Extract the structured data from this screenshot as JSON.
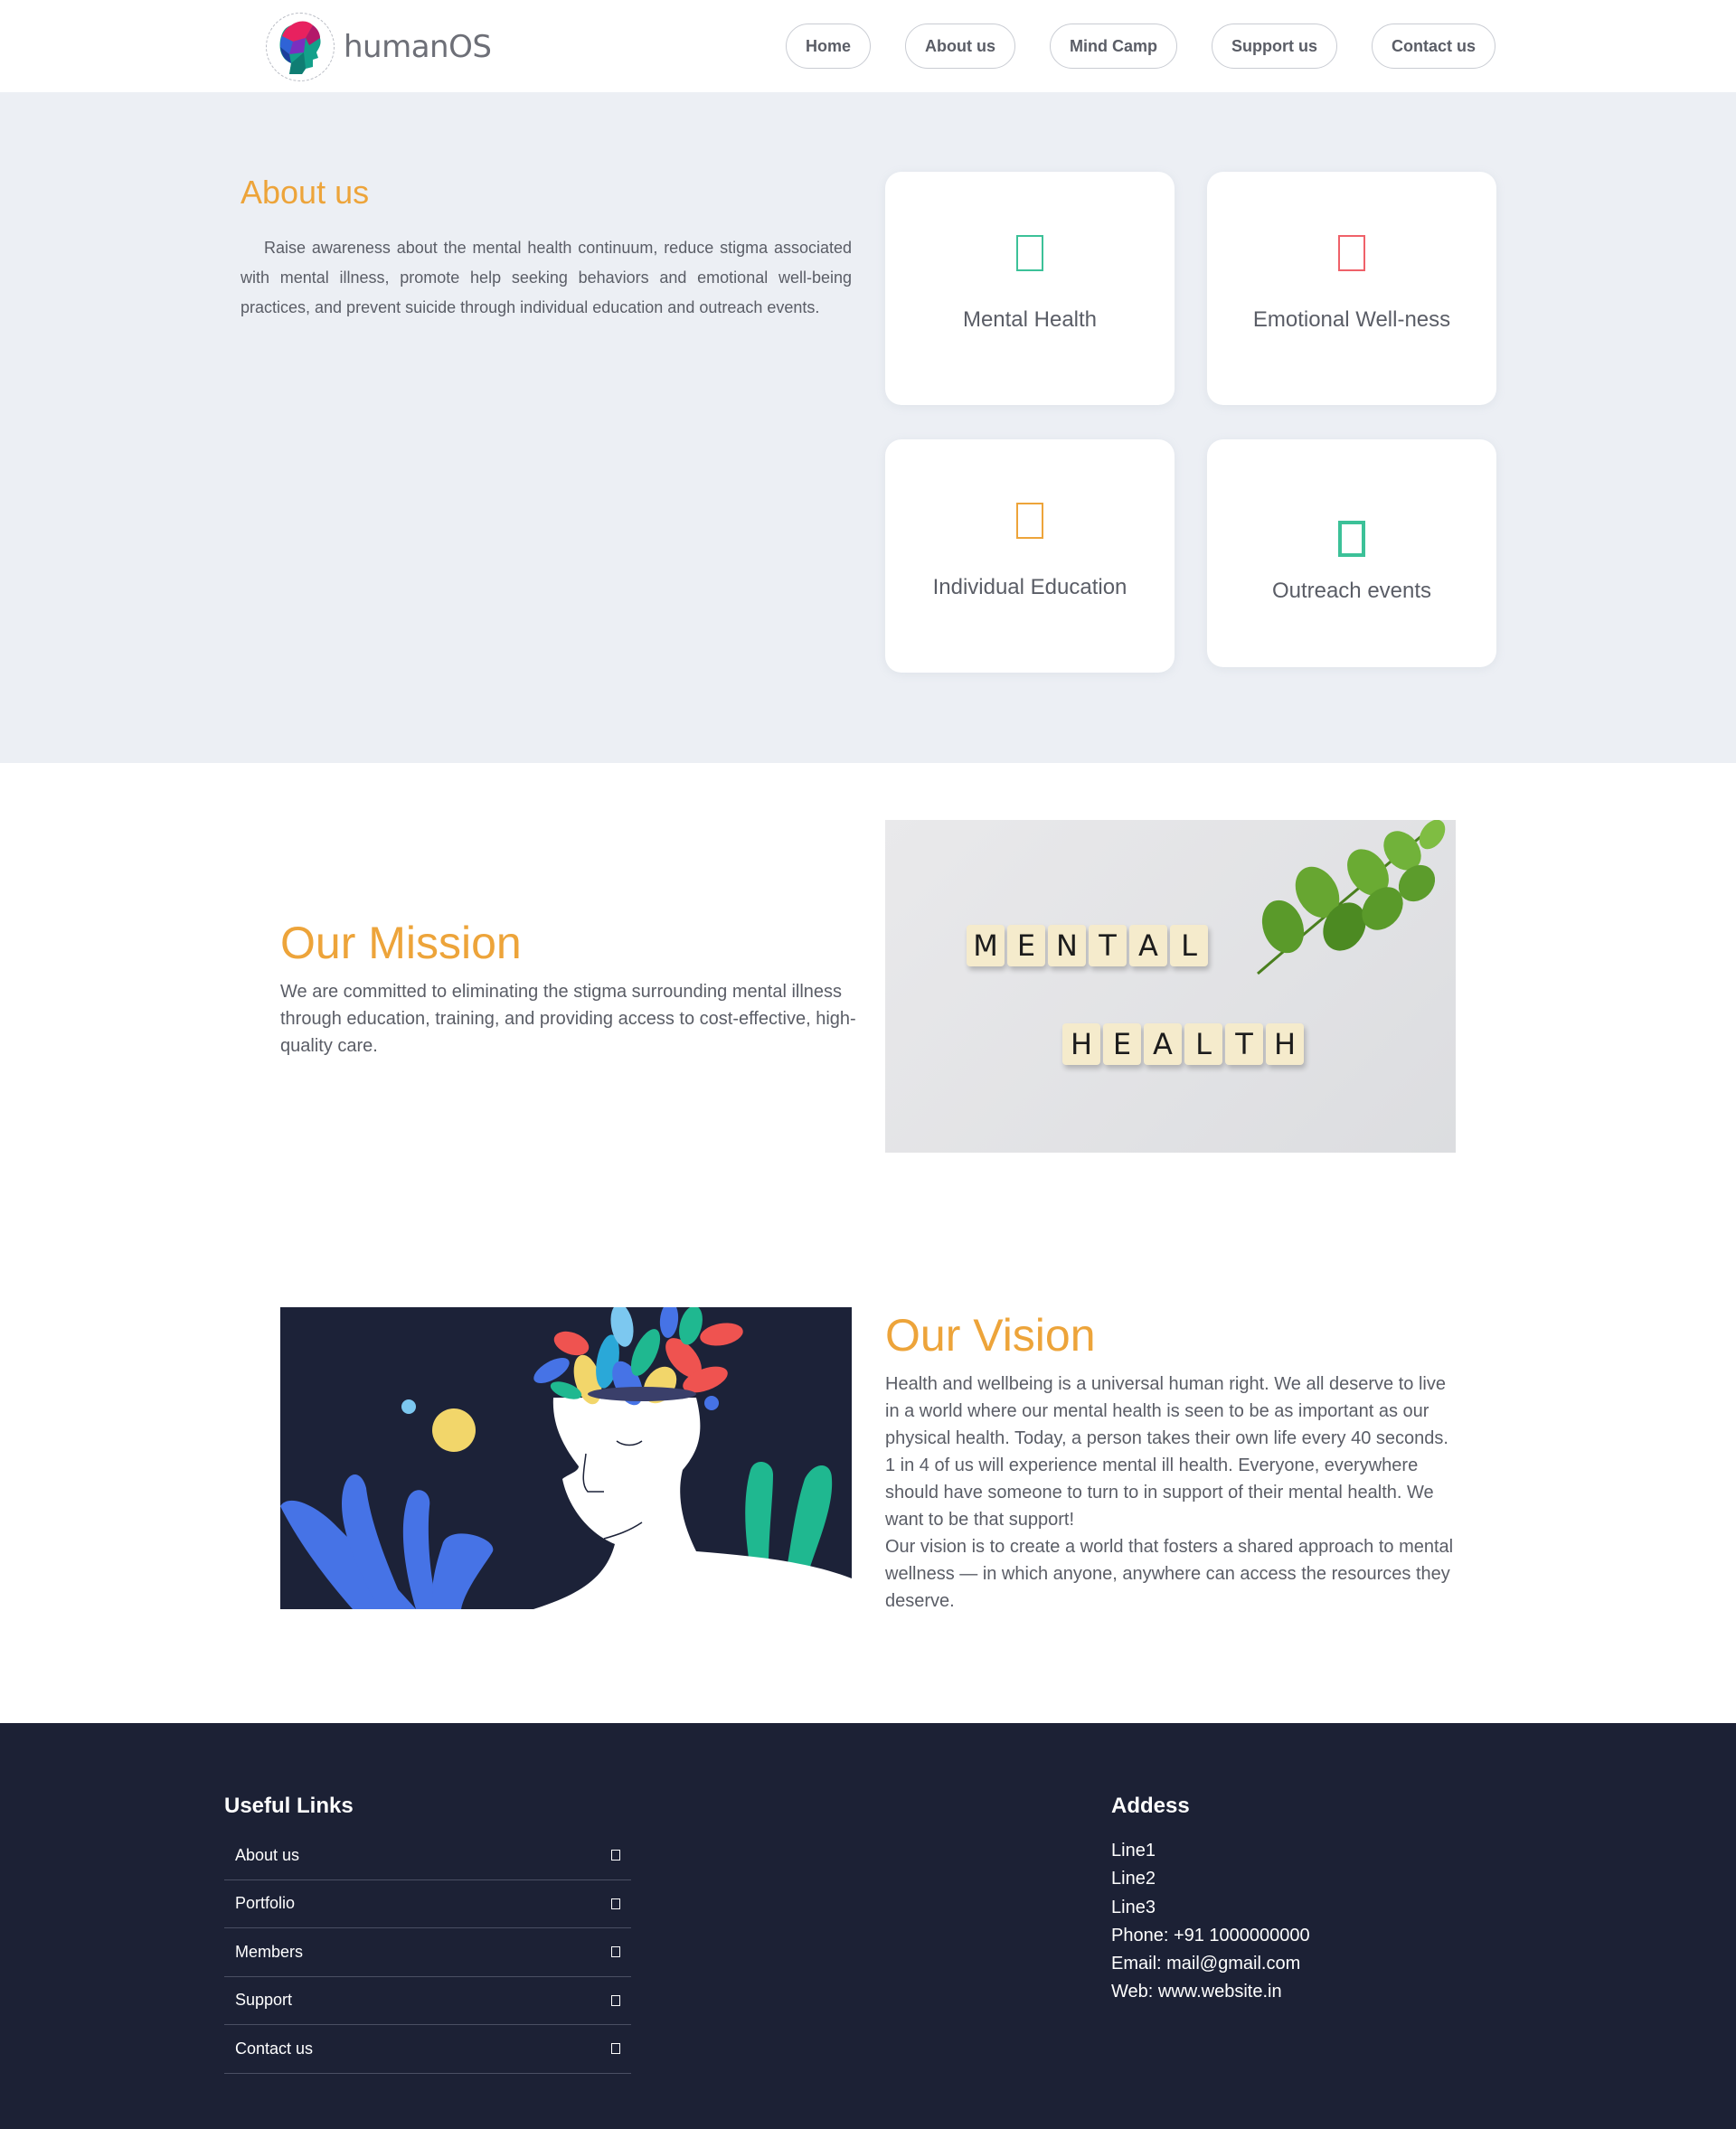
{
  "brand": {
    "name": "humanOS"
  },
  "nav": {
    "items": [
      "Home",
      "About us",
      "Mind Camp",
      "Support us",
      "Contact us"
    ]
  },
  "about": {
    "title": "About us",
    "text": "Raise awareness about the mental health continuum, reduce stigma associated with mental illness, promote help seeking behaviors and emotional well-being practices, and prevent suicide through individual education and outreach events.",
    "cards": [
      {
        "label": "Mental Health",
        "icon": "mental-health-icon",
        "color": "#3cc198"
      },
      {
        "label": "Emotional Well-ness",
        "icon": "wellness-icon",
        "color": "#ef6169"
      },
      {
        "label": "Individual Education",
        "icon": "education-icon",
        "color": "#eda43a"
      },
      {
        "label": "Outreach events",
        "icon": "outreach-icon",
        "color": "#3cc198"
      }
    ]
  },
  "mission": {
    "title": "Our Mission",
    "text": "We are committed to eliminating the stigma surrounding mental illness through education, training, and providing access to cost-effective, high-quality care.",
    "image_words": [
      "MENTAL",
      "HEALTH"
    ]
  },
  "vision": {
    "title": "Our Vision",
    "paragraphs": [
      "Health and wellbeing is a universal human right. We all deserve to live in a world where our mental health is seen to be as important as our physical health. Today, a person takes their own life every 40 seconds. 1 in 4 of us will experience mental ill health. Everyone, everywhere should have someone to turn to in support of their mental health. We want to be that support!",
      "Our vision is to create a world that fosters a shared approach to mental wellness — in which anyone, anywhere can access the resources they deserve."
    ]
  },
  "footer": {
    "links_title": "Useful Links",
    "links": [
      "About us",
      "Portfolio",
      "Members",
      "Support",
      "Contact us"
    ],
    "address_title": "Addess",
    "address_lines": [
      "Line1",
      "Line2",
      "Line3"
    ],
    "phone_label": "Phone:",
    "phone": "+91 1000000000",
    "email_label": "Email:",
    "email": "mail@gmail.com",
    "web_label": "Web:",
    "web": "www.website.in"
  },
  "colors": {
    "accent": "#eda43a",
    "footer_bg": "#1c2135",
    "section_bg": "#eceff4"
  }
}
